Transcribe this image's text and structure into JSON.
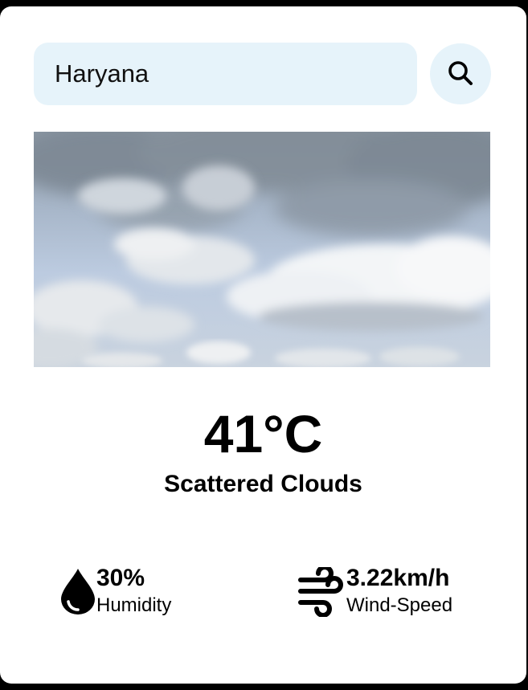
{
  "search": {
    "value": "Haryana",
    "icon": "search-icon"
  },
  "weather_image": {
    "icon": "scattered-clouds-photo"
  },
  "current": {
    "temperature": "41°C",
    "condition": "Scattered Clouds"
  },
  "stats": {
    "humidity": {
      "value": "30%",
      "label": "Humidity",
      "icon": "water-drop-icon"
    },
    "wind": {
      "value": "3.22km/h",
      "label": "Wind-Speed",
      "icon": "wind-icon"
    }
  },
  "colors": {
    "page_background": "#000000",
    "card_background": "#ffffff",
    "input_background": "#e6f3fa",
    "text": "#000000"
  }
}
